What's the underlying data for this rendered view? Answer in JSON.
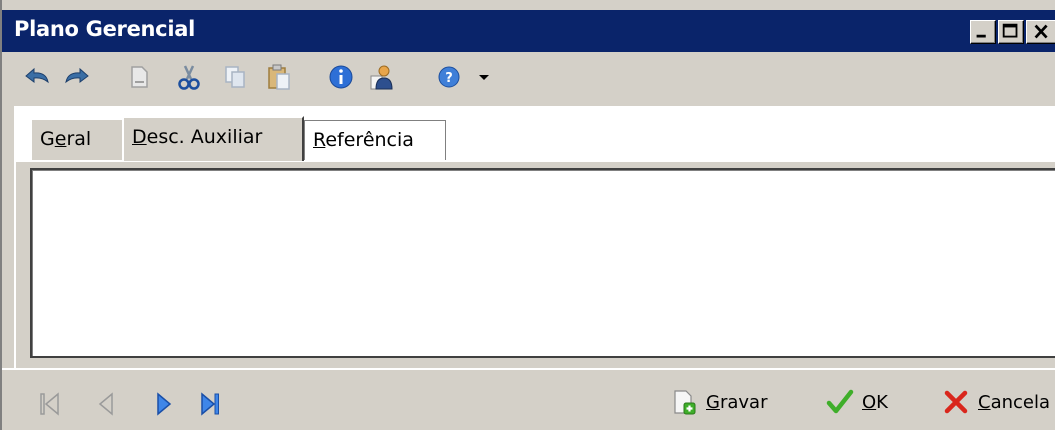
{
  "window": {
    "title": "Plano Gerencial",
    "controls": {
      "minimize": "minimize",
      "maximize": "maximize",
      "close": "close"
    }
  },
  "toolbar": {
    "icons": [
      "undo-icon",
      "redo-icon",
      "new-document-icon",
      "cut-icon",
      "copy-icon",
      "paste-icon",
      "info-icon",
      "user-icon",
      "help-icon",
      "dropdown-arrow-icon"
    ]
  },
  "tabs": [
    {
      "label_pre": "G",
      "label_ul": "e",
      "label_post": "ral",
      "active": false
    },
    {
      "label_pre": "",
      "label_ul": "D",
      "label_post": "esc. Auxiliar",
      "active": true
    },
    {
      "label_pre": "",
      "label_ul": "R",
      "label_post": "eferência",
      "active": false
    }
  ],
  "memo": {
    "value": ""
  },
  "statusbar": {
    "nav": [
      "first-record-icon",
      "prev-record-icon",
      "next-record-icon",
      "last-record-icon"
    ],
    "save": {
      "ul": "G",
      "rest": "ravar"
    },
    "ok": {
      "ul": "O",
      "rest": "K"
    },
    "cancel": {
      "ul": "C",
      "rest": "ancela"
    }
  },
  "colors": {
    "titlebar": "#0a246a",
    "face": "#d4d0c8",
    "nav_active": "#1e5fcf",
    "nav_disabled": "#9a9a9a",
    "ok_green": "#3fae2a",
    "cancel_red": "#d9261c"
  }
}
